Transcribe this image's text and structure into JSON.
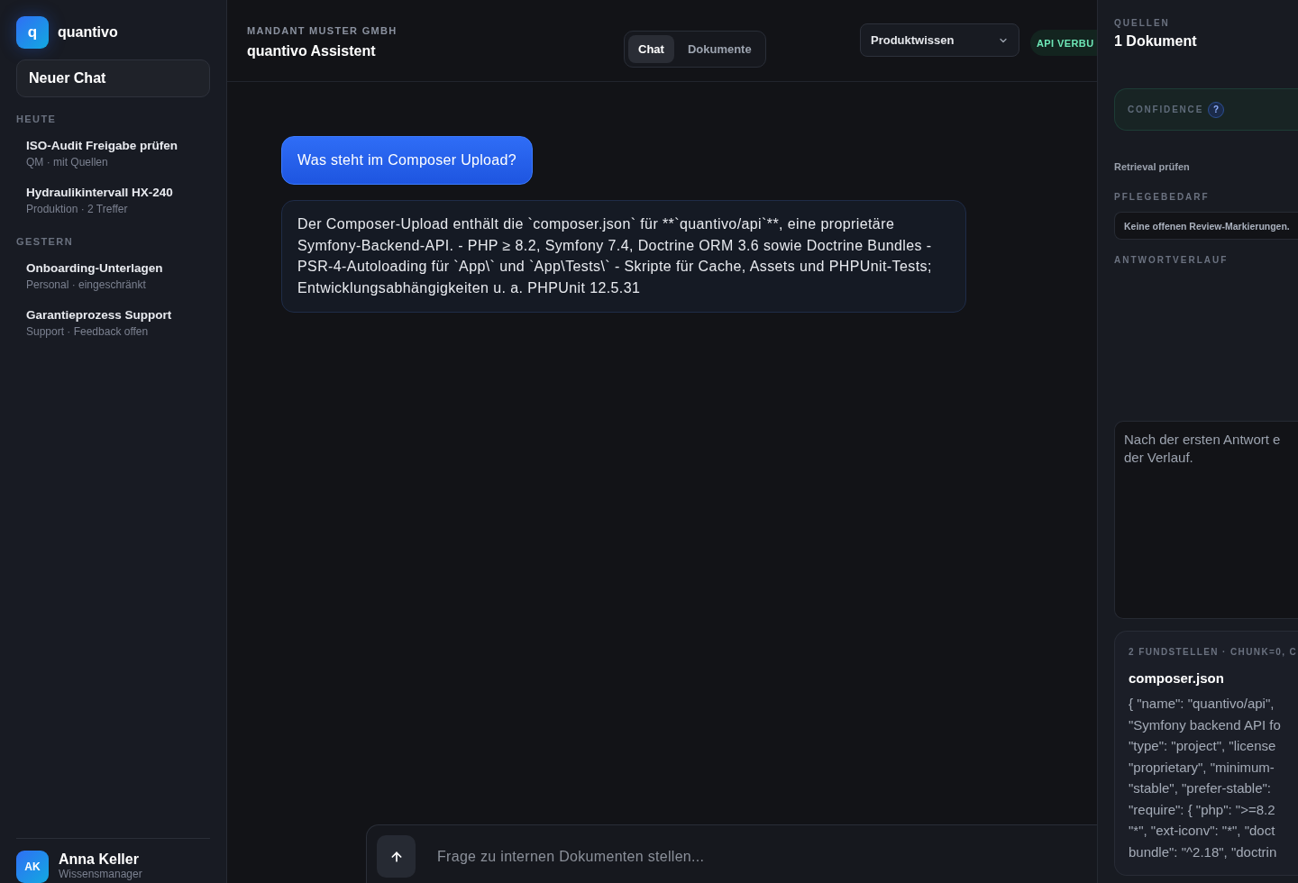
{
  "sidebar": {
    "brand": {
      "mark": "q",
      "name": "quantivo"
    },
    "new_chat_button": "Neuer Chat",
    "groups": [
      {
        "label": "HEUTE",
        "items": [
          {
            "title": "ISO-Audit Freigabe prüfen",
            "subtitle": "QM · mit Quellen",
            "selected": false
          },
          {
            "title": "Hydraulikintervall HX-240",
            "subtitle": "Produktion · 2 Treffer",
            "selected": false
          }
        ]
      },
      {
        "label": "GESTERN",
        "items": [
          {
            "title": "Onboarding-Unterlagen",
            "subtitle": "Personal · eingeschränkt",
            "selected": false
          },
          {
            "title": "Garantieprozess Support",
            "subtitle": "Support · Feedback offen",
            "selected": false
          }
        ]
      }
    ],
    "user": {
      "initials": "AK",
      "name": "Anna Keller",
      "role": "Wissensmanager"
    }
  },
  "header": {
    "tenant": "MANDANT MUSTER GMBH",
    "title": "quantivo Assistent",
    "tabs": [
      {
        "label": "Chat",
        "selected": true
      },
      {
        "label": "Dokumente",
        "selected": false
      }
    ],
    "knowledge_select": {
      "value": "Produktwissen"
    },
    "status_badge": "API VERBU"
  },
  "messages": [
    {
      "kind": "user",
      "text": "Was steht im Composer Upload?"
    },
    {
      "kind": "assistant",
      "text": "Der Composer-Upload enthält die `composer.json` für **`quantivo/api`**, eine proprietäre Symfony-Backend-API. - PHP ≥ 8.2, Symfony 7.4, Doctrine ORM 3.6 sowie Doctrine Bundles - PSR-4-Autoloading für `App\\` und `App\\Tests\\` - Skripte für Cache, Assets und PHPUnit-Tests; Entwicklungsabhängigkeiten u. a. PHPUnit 12.5.31"
    }
  ],
  "composer": {
    "placeholder": "Frage zu internen Dokumenten stellen..."
  },
  "sources_panel": {
    "label": "QUELLEN",
    "count": "1 Dokument",
    "confidence": {
      "label": "CONFIDENCE",
      "help": "?"
    },
    "retrieval_link": "Retrieval prüfen",
    "maintenance": {
      "label": "PFLEGEBEDARF",
      "text": "Keine offenen Review-Markierungen."
    },
    "history": {
      "label": "ANTWORTVERLAUF",
      "lines": [
        "Nach der ersten Antwort e",
        "der Verlauf."
      ]
    },
    "source_card": {
      "meta": "2 FUNDSTELLEN · CHUNK=0, C",
      "title": "composer.json",
      "snippet_lines": [
        "{ \"name\": \"quantivo/api\",",
        "\"Symfony backend API fo",
        "\"type\": \"project\", \"license",
        "\"proprietary\", \"minimum-",
        "\"stable\", \"prefer-stable\":",
        "\"require\": { \"php\": \">=8.2",
        "\"*\", \"ext-iconv\": \"*\", \"doct",
        "bundle\": \"^2.18\", \"doctrin"
      ]
    }
  }
}
